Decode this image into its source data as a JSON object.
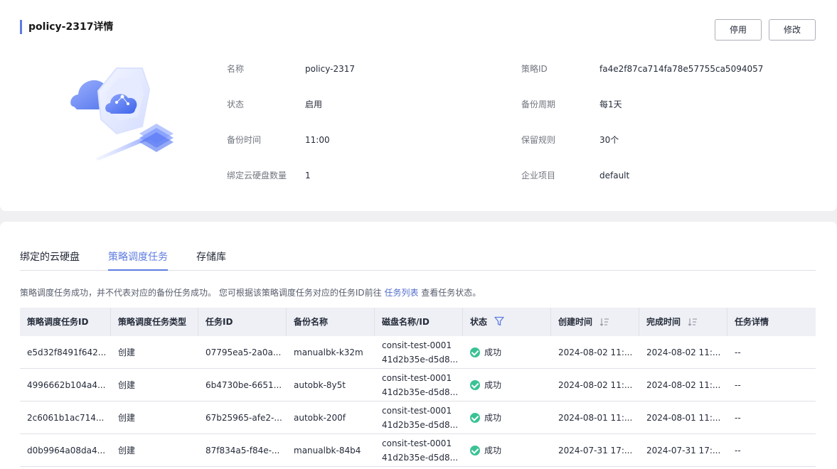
{
  "header": {
    "title": "policy-2317详情",
    "disable_label": "停用",
    "edit_label": "修改"
  },
  "info": {
    "left": [
      {
        "label": "名称",
        "value": "policy-2317"
      },
      {
        "label": "状态",
        "value": "启用"
      },
      {
        "label": "备份时间",
        "value": "11:00"
      },
      {
        "label": "绑定云硬盘数量",
        "value": "1"
      }
    ],
    "right": [
      {
        "label": "策略ID",
        "value": "fa4e2f87ca714fa78e57755ca5094057"
      },
      {
        "label": "备份周期",
        "value": "每1天"
      },
      {
        "label": "保留规则",
        "value": "30个"
      },
      {
        "label": "企业项目",
        "value": "default"
      }
    ]
  },
  "tabs": [
    {
      "label": "绑定的云硬盘",
      "active": false
    },
    {
      "label": "策略调度任务",
      "active": true
    },
    {
      "label": "存储库",
      "active": false
    }
  ],
  "notice": {
    "text_before": "策略调度任务成功，并不代表对应的备份任务成功。 您可根据该策略调度任务对应的任务ID前往",
    "link": "任务列表",
    "text_after": "查看任务状态。"
  },
  "table": {
    "headers": [
      "策略调度任务ID",
      "策略调度任务类型",
      "任务ID",
      "备份名称",
      "磁盘名称/ID",
      "状态",
      "创建时间",
      "完成时间",
      "任务详情"
    ],
    "rows": [
      {
        "id": "e5d32f8491f642...",
        "type": "创建",
        "task_id": "07795ea5-2a0a...",
        "backup": "manualbk-k32m",
        "disk_name": "consit-test-0001",
        "disk_id": "41d2b35e-d5d8...",
        "status": "成功",
        "created": "2024-08-02 11:...",
        "finished": "2024-08-02 11:...",
        "detail": "--"
      },
      {
        "id": "4996662b104a4...",
        "type": "创建",
        "task_id": "6b4730be-6651...",
        "backup": "autobk-8y5t",
        "disk_name": "consit-test-0001",
        "disk_id": "41d2b35e-d5d8...",
        "status": "成功",
        "created": "2024-08-02 11:...",
        "finished": "2024-08-02 11:...",
        "detail": "--"
      },
      {
        "id": "2c6061b1ac714...",
        "type": "创建",
        "task_id": "67b25965-afe2-...",
        "backup": "autobk-200f",
        "disk_name": "consit-test-0001",
        "disk_id": "41d2b35e-d5d8...",
        "status": "成功",
        "created": "2024-08-01 11:...",
        "finished": "2024-08-01 11:...",
        "detail": "--"
      },
      {
        "id": "d0b9964a08da4...",
        "type": "创建",
        "task_id": "87f834a5-f84e-...",
        "backup": "manualbk-84b4",
        "disk_name": "consit-test-0001",
        "disk_id": "41d2b35e-d5d8...",
        "status": "成功",
        "created": "2024-07-31 17:...",
        "finished": "2024-07-31 17:...",
        "detail": "--"
      }
    ]
  },
  "colors": {
    "accent": "#5e7ce0",
    "success": "#3ac295",
    "link": "#526ecc"
  }
}
